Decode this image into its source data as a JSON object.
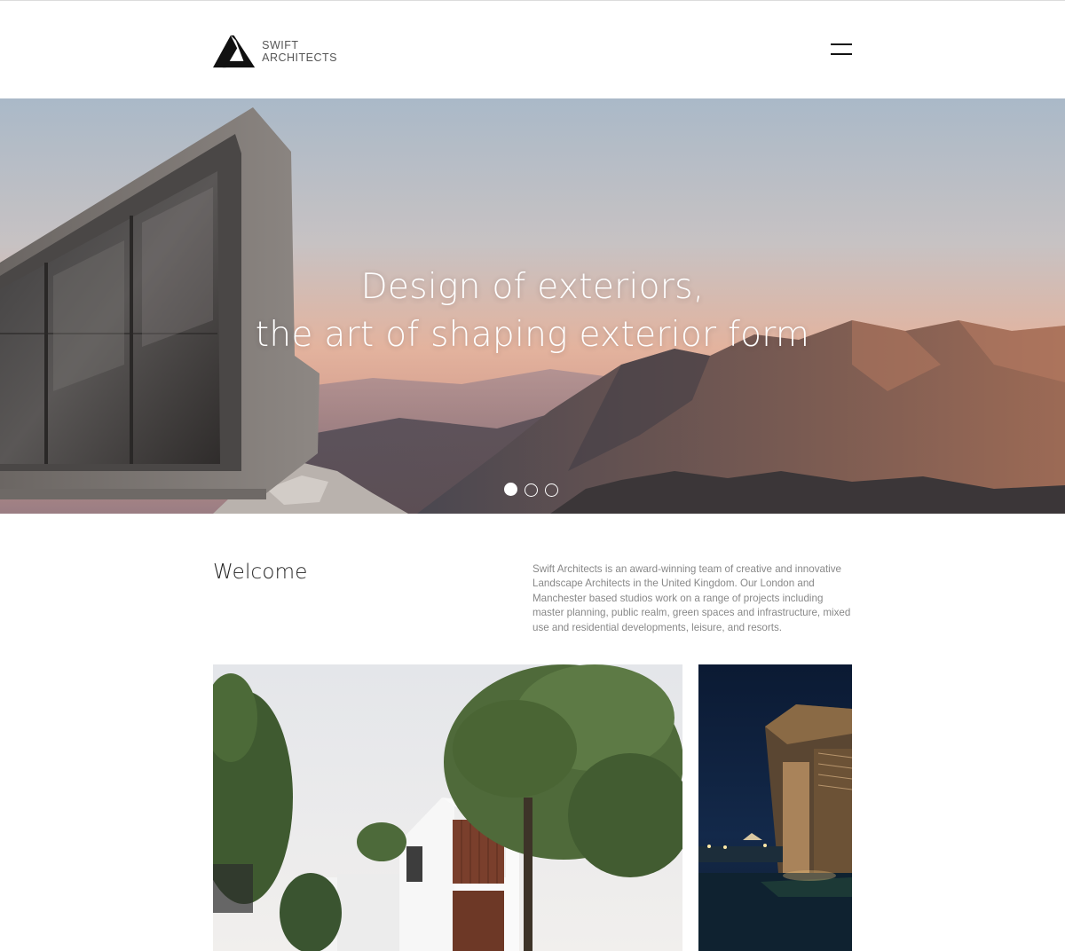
{
  "header": {
    "logo_line1": "SWIFT",
    "logo_line2": "ARCHITECTS",
    "menu_icon": "hamburger-icon"
  },
  "hero": {
    "headline_line1": "Design of exteriors,",
    "headline_line2": "the art of shaping exterior form",
    "slides": 3,
    "active_slide": 1
  },
  "welcome": {
    "title": "Welcome",
    "body": "Swift Architects is an award-winning team of creative and innovative Landscape Architects in the United Kingdom. Our London and Manchester based studios work on a range of projects including master planning, public realm, green spaces and infrastructure, mixed use and residential developments, leisure, and resorts."
  },
  "colors": {
    "accent": "#111111",
    "muted_text": "#888888"
  }
}
